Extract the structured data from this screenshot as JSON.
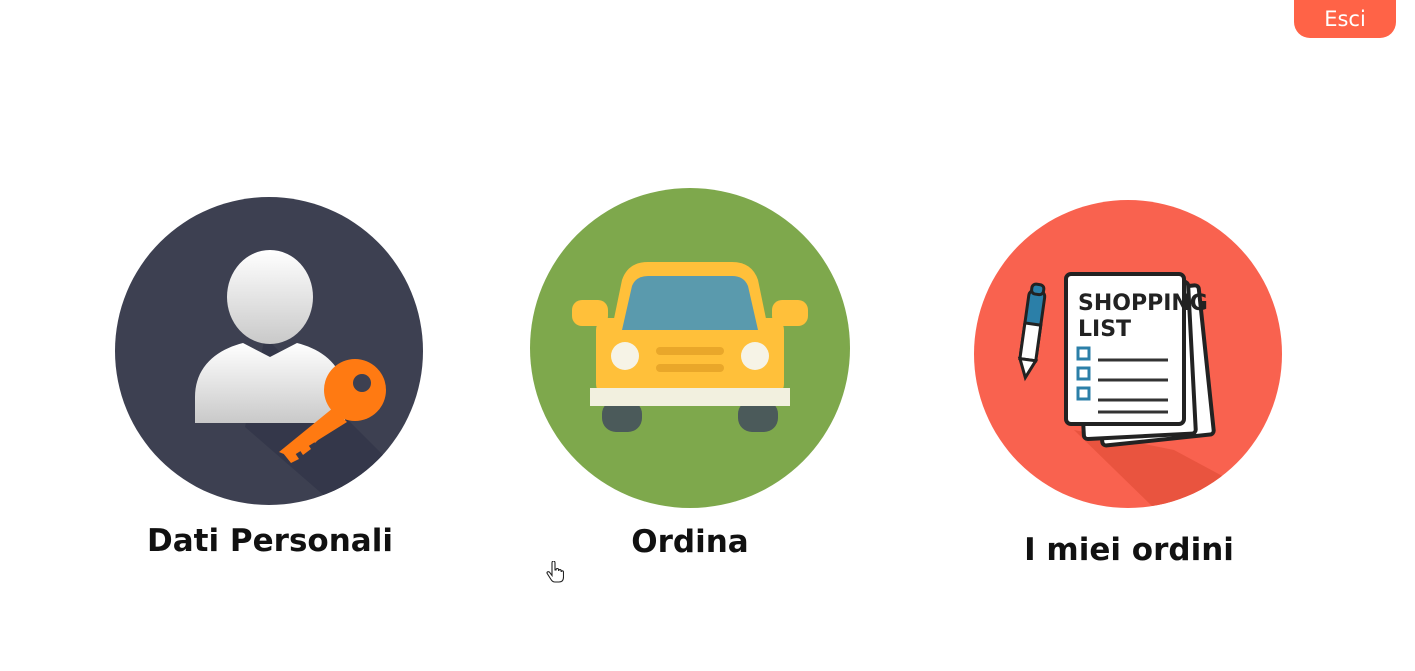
{
  "header": {
    "exit_label": "Esci",
    "exit_color": "#ff6347"
  },
  "tiles": [
    {
      "label": "Dati Personali",
      "icon": "user-key-icon",
      "circle_color": "#3d4051"
    },
    {
      "label": "Ordina",
      "icon": "car-icon",
      "circle_color": "#7ea84c"
    },
    {
      "label": "I miei ordini",
      "icon": "shopping-list-icon",
      "circle_color": "#f9624f"
    }
  ],
  "shopping_list_icon_text": {
    "line1": "SHOPPING",
    "line2": "LIST"
  },
  "colors": {
    "key": "#ff7a12",
    "car_body": "#ffc03a",
    "car_window": "#5a9aad"
  }
}
